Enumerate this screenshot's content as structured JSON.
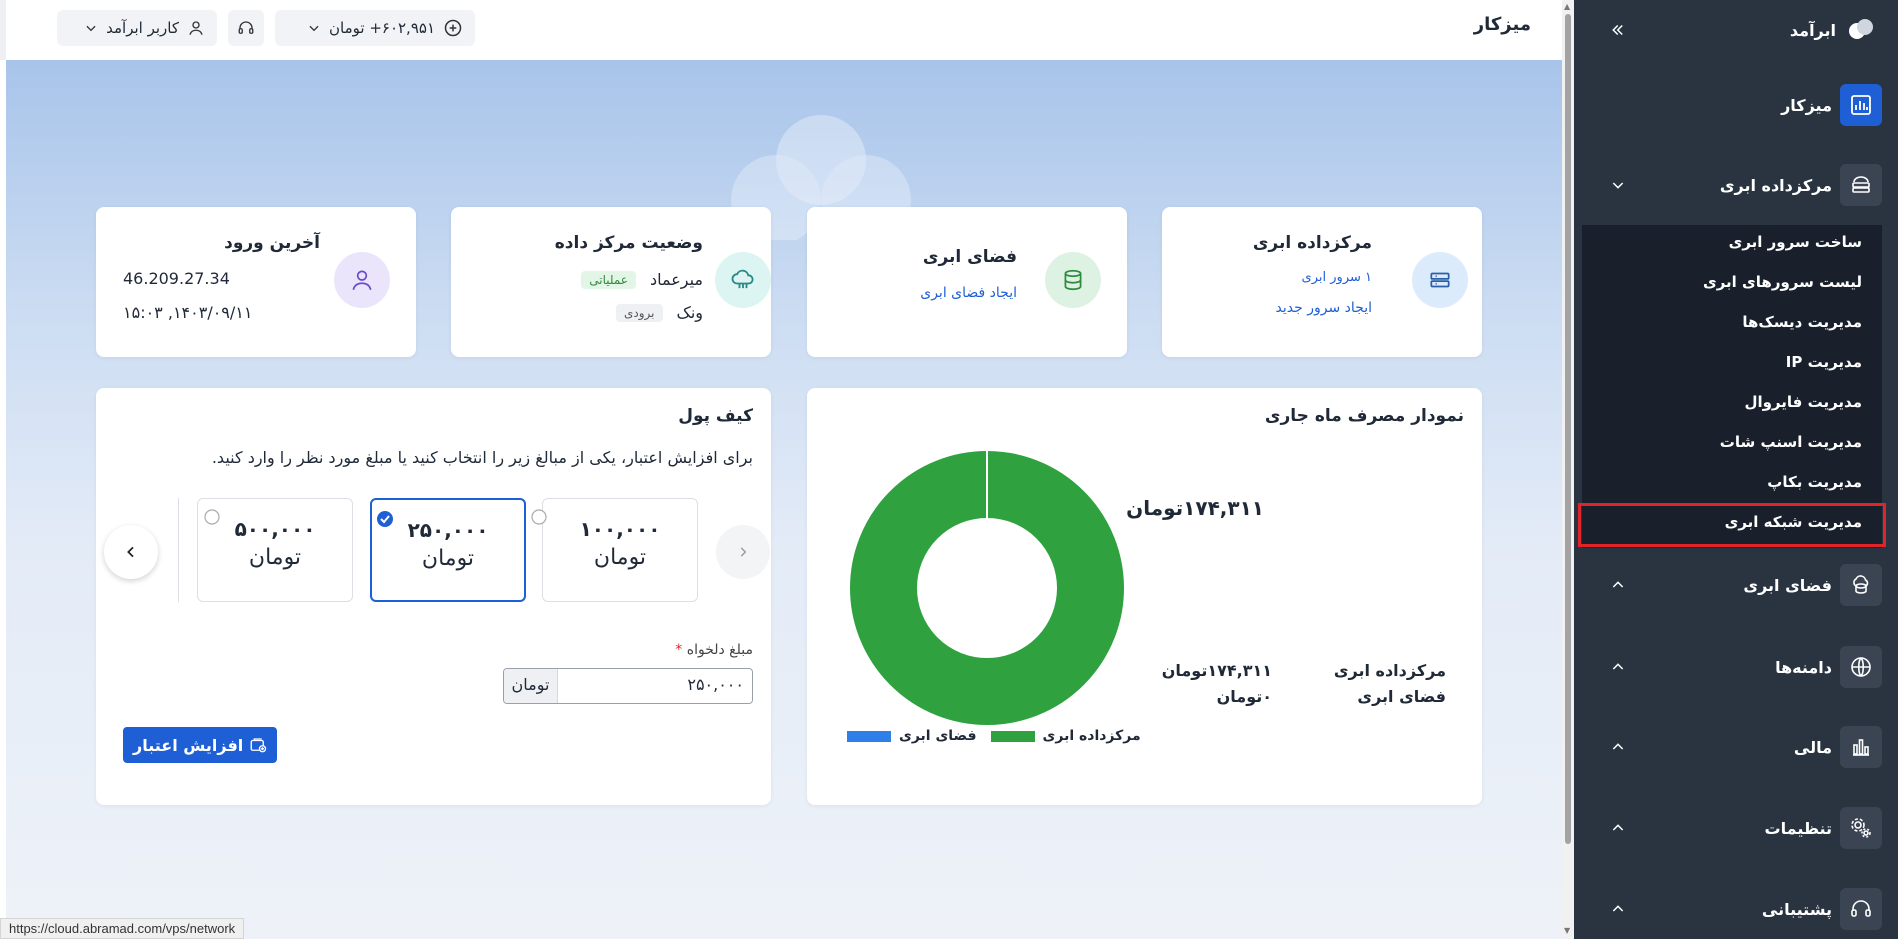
{
  "topbar": {
    "title": "میزکار",
    "user_label": "کاربر ابرآمد",
    "balance_label": "۶۰۲,۹۵۱+ تومان"
  },
  "cards": {
    "datacenter": {
      "title": "مرکزداده ابری",
      "count_text": "۱ سرور ابری",
      "link": "ایجاد سرور جدید"
    },
    "space": {
      "title": "فضای ابری",
      "link": "ایجاد فضای ابری"
    },
    "status": {
      "title": "وضعیت مرکز داده",
      "rows": [
        {
          "name": "میرعماد",
          "badge": "عملیاتی"
        },
        {
          "name": "ونک",
          "badge": "برودی"
        }
      ]
    },
    "login": {
      "title": "آخرین ورود",
      "ip": "46.209.27.34",
      "time": "۱۴۰۳/۰۹/۱۱, ۱۵:۰۳"
    }
  },
  "chart_card": {
    "title": "نمودار مصرف ماه جاری",
    "callout": "۱۷۴,۳۱۱تومان",
    "summary_labels": [
      "مرکزداده ابری",
      "فضای ابری"
    ],
    "summary_values": [
      "۱۷۴,۳۱۱تومان",
      "۰تومان"
    ]
  },
  "chart_data": {
    "type": "pie",
    "donut": true,
    "categories": [
      "مرکزداده ابری",
      "فضای ابری"
    ],
    "values": [
      174311,
      0
    ],
    "colors": [
      "#2fa23f",
      "#2f7fe8"
    ],
    "legend": "bottom"
  },
  "wallet": {
    "title": "کیف پول",
    "description": "برای افزایش اعتبار، یکی از مبالغ زیر را انتخاب کنید یا مبلغ مورد نظر را وارد کنید.",
    "amounts": [
      {
        "value": "۱۰۰,۰۰۰",
        "unit": "تومان",
        "selected": false
      },
      {
        "value": "۲۵۰,۰۰۰",
        "unit": "تومان",
        "selected": true
      },
      {
        "value": "۵۰۰,۰۰۰",
        "unit": "تومان",
        "selected": false
      }
    ],
    "custom_label": "مبلغ دلخواه",
    "required_mark": "*",
    "custom_value": "۲۵۰,۰۰۰",
    "custom_unit": "تومان",
    "submit_label": "افزایش اعتبار"
  },
  "sidebar": {
    "brand": "ابرآمد",
    "items": [
      {
        "label": "میزکار",
        "icon": "dashboard-icon"
      },
      {
        "label": "مرکزداده ابری",
        "icon": "server-icon"
      },
      {
        "label": "فضای ابری",
        "icon": "storage-icon"
      },
      {
        "label": "دامنه‌ها",
        "icon": "globe-icon"
      },
      {
        "label": "مالی",
        "icon": "finance-icon"
      },
      {
        "label": "تنظیمات",
        "icon": "settings-icon"
      },
      {
        "label": "پشتیبانی",
        "icon": "headset-icon"
      }
    ],
    "submenu": [
      "ساخت سرور ابری",
      "لیست سرورهای ابری",
      "مدیریت دیسک‌ها",
      "مدیریت IP",
      "مدیریت فایروال",
      "مدیریت اسنپ شات",
      "مدیریت بکاپ",
      "مدیریت شبکه ابری"
    ]
  },
  "status_bar": {
    "url": "https://cloud.abramad.com/vps/network"
  },
  "colors": {
    "primary": "#1f5fd6",
    "sidebar": "#2a3441",
    "submenu": "#19202b",
    "highlight": "#e0242a",
    "chart_green": "#2fa23f",
    "chart_blue": "#2f7fe8"
  }
}
